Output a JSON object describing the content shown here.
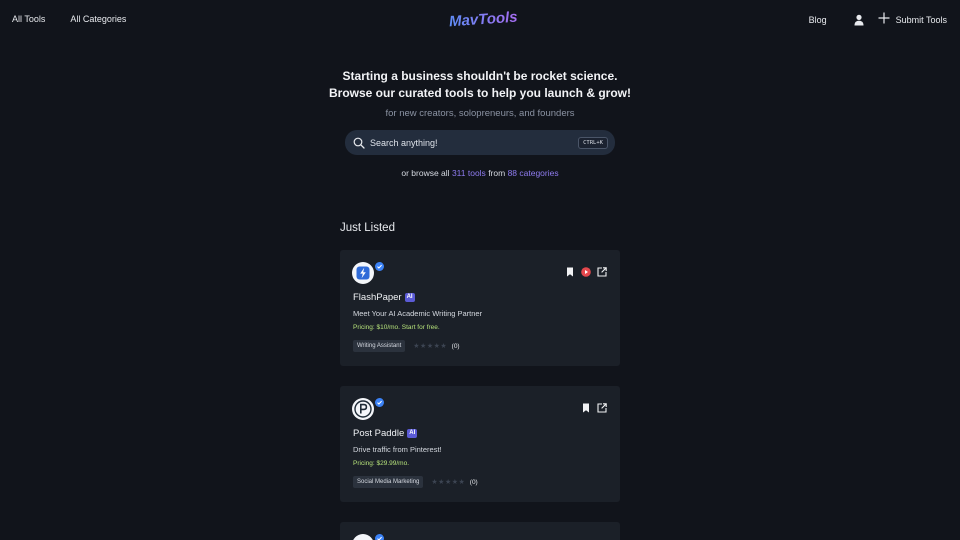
{
  "nav": {
    "all_tools": "All Tools",
    "all_categories": "All Categories",
    "logo": "MavTools",
    "blog": "Blog",
    "submit_tools": "Submit Tools"
  },
  "hero": {
    "line1": "Starting a business shouldn't be rocket science.",
    "line2": "Browse our curated tools to help you launch & grow!",
    "subtitle": "for new creators, solopreneurs, and founders"
  },
  "search": {
    "placeholder": "Search anything!",
    "shortcut": "CTRL+K"
  },
  "browse": {
    "prefix": "or browse all",
    "tools_count": "311 tools",
    "middle": "from",
    "categories_count": "88 categories"
  },
  "section_title": "Just Listed",
  "listings": [
    {
      "name": "FlashPaper",
      "badge": "AI",
      "tagline": "Meet Your AI Academic Writing Partner",
      "pricing": "Pricing: $10/mo. Start for free.",
      "category": "Writing Assistant",
      "rating_count": "(0)",
      "rating": 0,
      "icon": "lightning-bolt-icon"
    },
    {
      "name": "Post Paddle",
      "badge": "AI",
      "tagline": "Drive traffic from Pinterest!",
      "pricing": "Pricing: $29.99/mo.",
      "category": "Social Media Marketing",
      "rating_count": "(0)",
      "rating": 0,
      "icon": "letter-p-icon"
    }
  ],
  "colors": {
    "background": "#11141b",
    "card": "#1b2028",
    "accent": "#8f7cf0",
    "pricing": "#b6e27a",
    "verified": "#3b82f6",
    "ai_badge": "#5b5bd6"
  }
}
